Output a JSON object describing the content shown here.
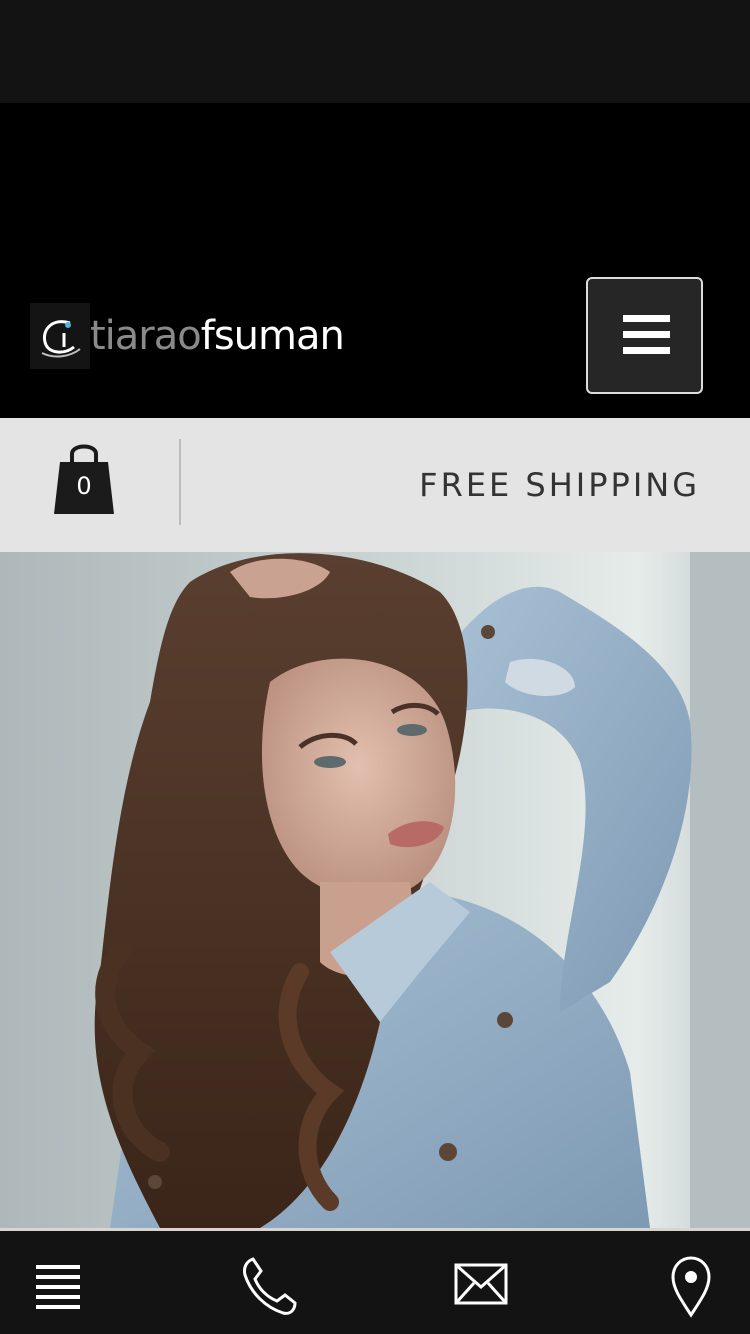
{
  "header": {
    "logo": {
      "text_light": "tiarao",
      "text_bold": "fsuman",
      "alt": "tiaraofsuman"
    },
    "menu_icon": "hamburger-menu-icon"
  },
  "promo_bar": {
    "cart_count": "0",
    "cart_icon": "shopping-bag-icon",
    "message": "FREE SHIPPING"
  },
  "hero": {
    "image_description": "woman-denim-shirt-portrait"
  },
  "bottom_nav": {
    "items": [
      {
        "icon": "list-menu-icon"
      },
      {
        "icon": "phone-icon"
      },
      {
        "icon": "mail-icon"
      },
      {
        "icon": "location-pin-icon"
      }
    ]
  },
  "colors": {
    "header_bg": "#000000",
    "status_bg": "#131313",
    "promo_bg": "#e4e4e4",
    "promo_text": "#333333",
    "nav_bg": "#131313"
  }
}
